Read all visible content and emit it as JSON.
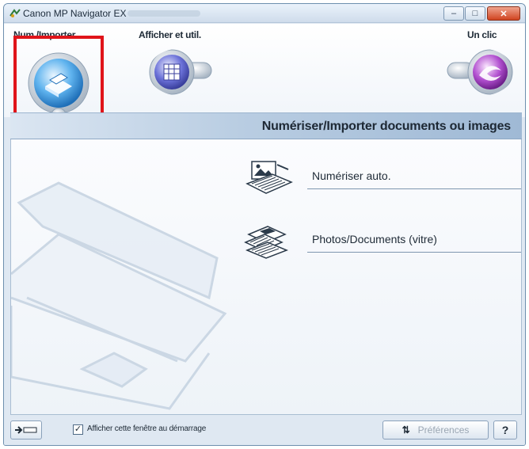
{
  "window": {
    "title": "Canon MP Navigator EX",
    "min_glyph": "–",
    "max_glyph": "□",
    "close_glyph": "✕"
  },
  "tabs": [
    {
      "label": "Num./Importer",
      "selected": true
    },
    {
      "label": "Afficher et util.",
      "selected": false
    },
    {
      "label": "Un clic",
      "selected": false
    }
  ],
  "header": {
    "title": "Numériser/Importer documents ou images"
  },
  "actions": [
    {
      "label": "Numériser auto.",
      "icon": "auto-scan-icon"
    },
    {
      "label": "Photos/Documents (vitre)",
      "icon": "photos-documents-icon"
    }
  ],
  "footer": {
    "startup_checkbox_label": "Afficher cette fenêtre au démarrage",
    "startup_checked": true,
    "check_glyph": "✓",
    "preferences_label": "Préférences",
    "preferences_glyph": "⇅",
    "help_label": "?"
  },
  "colors": {
    "highlight": "#e0141a",
    "header_band": "#b9cde2",
    "accent": "#3c8fd8"
  }
}
